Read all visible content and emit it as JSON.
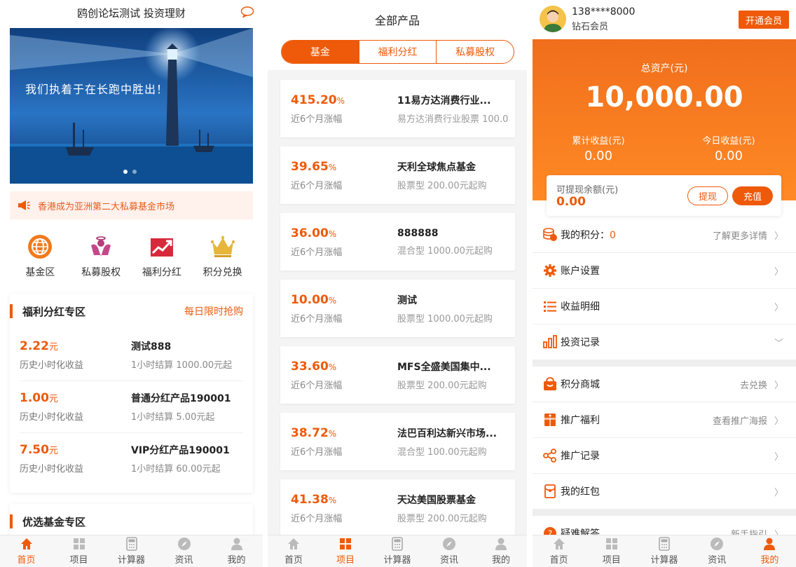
{
  "colors": {
    "accent": "#ee5a0a",
    "notice_bg": "#fff1ec"
  },
  "home": {
    "title": "鸥创论坛测试 投资理财",
    "banner_text": "我们执着于在长跑中胜出！",
    "notice": "香港成为亚洲第二大私募基金市场",
    "quick": [
      {
        "label": "基金区",
        "icon": "globe-icon"
      },
      {
        "label": "私募股权",
        "icon": "angel-icon"
      },
      {
        "label": "福利分红",
        "icon": "trend-chart-icon"
      },
      {
        "label": "积分兑换",
        "icon": "crown-icon"
      }
    ],
    "dividend_section": {
      "title": "福利分红专区",
      "more": "每日限时抢购",
      "items": [
        {
          "rate": "2.22",
          "unit": "元",
          "sub": "历史小时化收益",
          "name": "测试888",
          "desc": "1小时结算 1000.00元起"
        },
        {
          "rate": "1.00",
          "unit": "元",
          "sub": "历史小时化收益",
          "name": "普通分红产品190001",
          "desc": "1小时结算 5.00元起"
        },
        {
          "rate": "7.50",
          "unit": "元",
          "sub": "历史小时化收益",
          "name": "VIP分红产品190001",
          "desc": "1小时结算 60.00元起"
        }
      ]
    },
    "fund_section": {
      "title": "优选基金专区"
    }
  },
  "products": {
    "title": "全部产品",
    "tabs": [
      "基金",
      "福利分红",
      "私募股权"
    ],
    "items": [
      {
        "rate": "415.20",
        "unit": "%",
        "sub": "近6个月涨幅",
        "name": "11易方达消费行业...",
        "desc": "易方达消费行业股票 100.0"
      },
      {
        "rate": "39.65",
        "unit": "%",
        "sub": "近6个月涨幅",
        "name": "天利全球焦点基金",
        "desc": "股票型 200.00元起购"
      },
      {
        "rate": "36.00",
        "unit": "%",
        "sub": "近6个月涨幅",
        "name": "888888",
        "desc": "混合型 1000.00元起购"
      },
      {
        "rate": "10.00",
        "unit": "%",
        "sub": "近6个月涨幅",
        "name": "测试",
        "desc": "股票型 1000.00元起购"
      },
      {
        "rate": "33.60",
        "unit": "%",
        "sub": "近6个月涨幅",
        "name": "MFS全盛美国集中...",
        "desc": "股票型 200.00元起购"
      },
      {
        "rate": "38.72",
        "unit": "%",
        "sub": "近6个月涨幅",
        "name": "法巴百利达新兴市场...",
        "desc": "混合型 100.00元起购"
      },
      {
        "rate": "41.38",
        "unit": "%",
        "sub": "近6个月涨幅",
        "name": "天达美国股票基金",
        "desc": "股票型 200.00元起购"
      }
    ]
  },
  "mine": {
    "phone": "138****8000",
    "level": "钻石会员",
    "vip_button": "开通会员",
    "total_label": "总资产(元)",
    "total_value": "10,000.00",
    "cum_label": "累计收益(元)",
    "cum_value": "0.00",
    "today_label": "今日收益(元)",
    "today_value": "0.00",
    "withdrawable_label": "可提现余额(元)",
    "withdrawable_value": "0.00",
    "withdraw_button": "提现",
    "recharge_button": "充值",
    "menu1": [
      {
        "label": "我的积分：",
        "value": "0",
        "hint": "了解更多详情",
        "icon": "coins-icon"
      },
      {
        "label": "账户设置",
        "hint": "",
        "icon": "gear-icon"
      },
      {
        "label": "收益明细",
        "hint": "",
        "icon": "list-icon"
      },
      {
        "label": "投资记录",
        "hint": "",
        "icon": "bar-chart-icon"
      }
    ],
    "menu2": [
      {
        "label": "积分商城",
        "hint": "去兑换",
        "icon": "basket-icon"
      },
      {
        "label": "推广福利",
        "hint": "查看推广海报",
        "icon": "gift-icon"
      },
      {
        "label": "推广记录",
        "hint": "",
        "icon": "share-icon"
      },
      {
        "label": "我的红包",
        "hint": "",
        "icon": "red-envelope-icon"
      }
    ],
    "partial_item": {
      "label": "疑难解答",
      "hint": "新手指引"
    }
  },
  "tabbar": [
    "首页",
    "项目",
    "计算器",
    "资讯",
    "我的"
  ]
}
